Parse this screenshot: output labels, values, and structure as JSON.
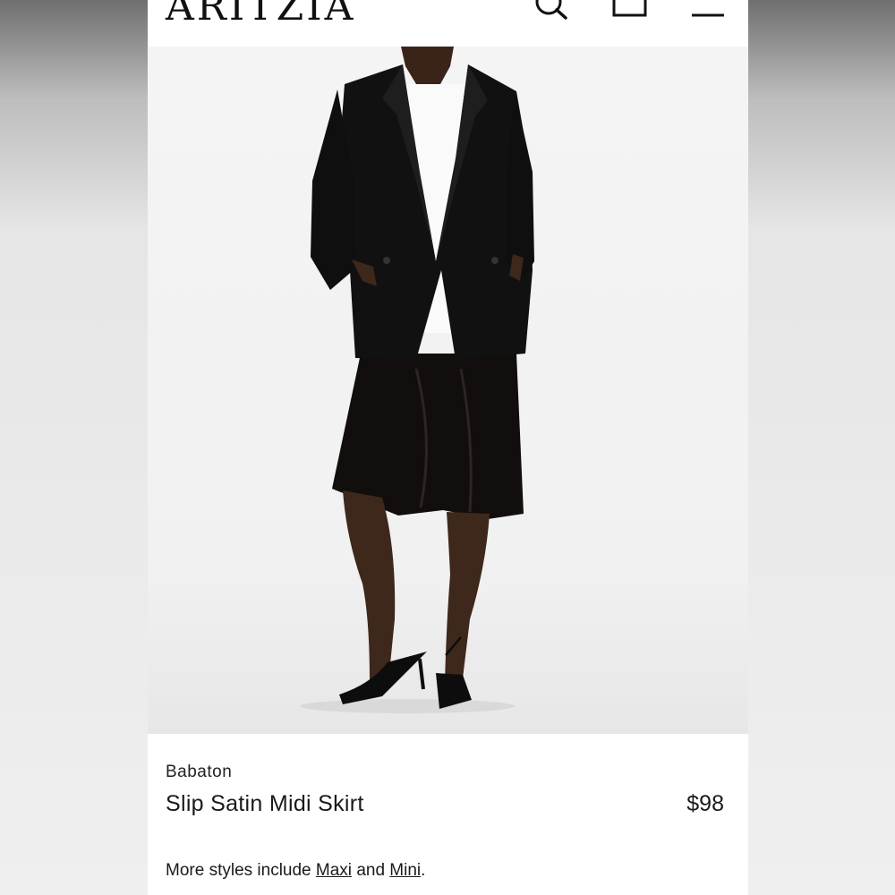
{
  "header": {
    "logo": "ARITZIA",
    "icons": [
      "search-icon",
      "bag-icon",
      "menu-icon"
    ]
  },
  "product": {
    "brand": "Babaton",
    "name": "Slip Satin Midi Skirt",
    "price": "$98",
    "more_styles": {
      "prefix": "More styles include",
      "link1": "Maxi",
      "middle": "and",
      "link2": "Mini",
      "suffix": "."
    }
  },
  "colors": {
    "text": "#1a1a1a",
    "background": "#ffffff"
  }
}
